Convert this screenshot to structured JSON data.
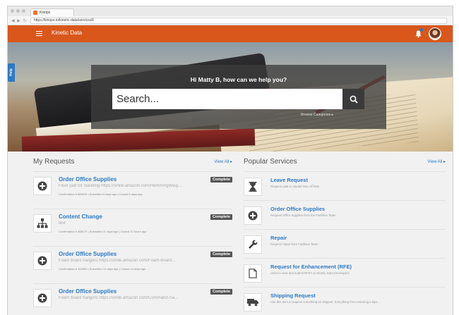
{
  "browser": {
    "tab_title": "Kinops",
    "url": "https://kinops.io/kinetic-data/servicesR",
    "nav": "◀ ▶ ↻"
  },
  "app": {
    "brand": "Kinetic Data",
    "accent_color": "#d9571b",
    "link_color": "#2b79c4"
  },
  "help_tab": "Help",
  "hero": {
    "greeting": "Hi Matty B, how can we help you?",
    "search_placeholder": "Search...",
    "browse_label": "Browse Categories ▸"
  },
  "my_requests": {
    "title": "My Requests",
    "view_all": "View All ▸",
    "items": [
      {
        "title": "Order Office Supplies",
        "status": "Complete",
        "description": "Floor pad for standing https://smile.amazon.com/HemmingWeig...",
        "meta": "Confirmation # 689978 | Submitted 5 days ago | Closed 5 days ago",
        "icon": "plus-circle-icon"
      },
      {
        "title": "Content Change",
        "status": "Complete",
        "description": "test",
        "meta": "Confirmation # 488170 | Submitted 11 days ago | Closed 10 hours ago",
        "icon": "sitemap-icon"
      },
      {
        "title": "Order Office Supplies",
        "status": "Complete",
        "description": "Foam board hangers https://smile.amazon.com/Foam-Board...",
        "meta": "Confirmation # 104363 | Submitted 14 days ago | Closed 14 days ago",
        "icon": "plus-circle-icon"
      },
      {
        "title": "Order Office Supplies",
        "status": "Complete",
        "description": "Foam board hangers https://smile.amazon.com/Command-Sa...",
        "meta": "",
        "icon": "plus-circle-icon"
      }
    ]
  },
  "popular_services": {
    "title": "Popular Services",
    "view_all": "View All ▸",
    "items": [
      {
        "title": "Leave Request",
        "description": "Request paid or unpaid time off here",
        "icon": "hourglass-icon"
      },
      {
        "title": "Order Office Supplies",
        "description": "Request Office Supplies from the Facilities Team",
        "icon": "plus-circle-icon"
      },
      {
        "title": "Repair",
        "description": "Request repair from Facilities Team",
        "icon": "wrench-icon"
      },
      {
        "title": "Request for Enhancement (RFE)",
        "description": "Used to view and submit RFE's to Kinetic Data Developers",
        "icon": "document-icon"
      },
      {
        "title": "Shipping Request",
        "description": "Use this item to request something be shipped. Everything from returning a lapt...",
        "icon": "truck-icon"
      }
    ]
  }
}
